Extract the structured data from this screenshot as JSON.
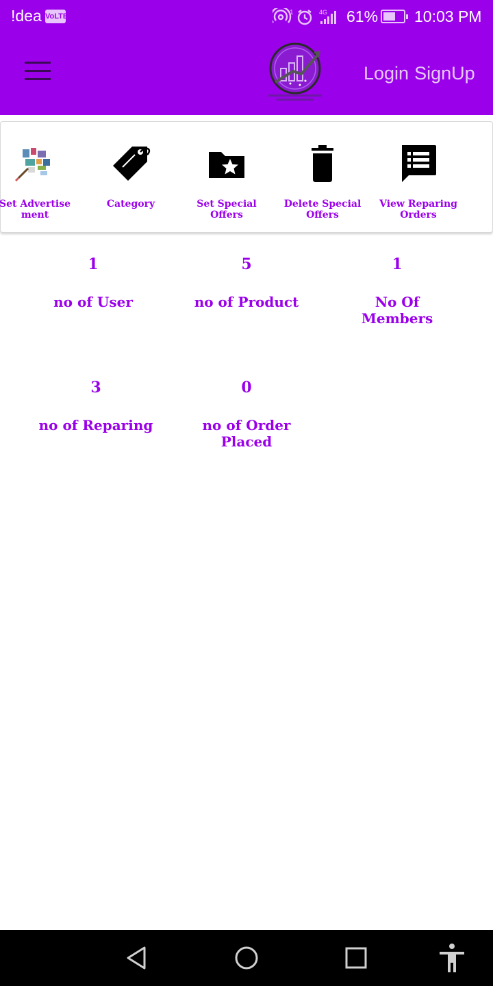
{
  "status_bar": {
    "carrier": "!dea",
    "volte": "VoLTE",
    "network_tag": "4G",
    "battery_pct": "61%",
    "battery_level": 0.61,
    "time": "10:03 PM"
  },
  "app_bar": {
    "menu_icon": "hamburger-icon",
    "logo_icon": "mobilesolution-logo",
    "login_label": "Login",
    "signup_label": "SignUp"
  },
  "actions": [
    {
      "label": "Set Advertise ment",
      "icon": "advertisement-icon"
    },
    {
      "label": "Category",
      "icon": "tag-icon"
    },
    {
      "label": "Set Special Offers",
      "icon": "folder-star-icon"
    },
    {
      "label": "Delete Special Offers",
      "icon": "trash-icon"
    },
    {
      "label": "View Reparing Orders",
      "icon": "message-list-icon"
    }
  ],
  "stats": [
    {
      "value": "1",
      "label": "no of User"
    },
    {
      "value": "5",
      "label": "no of Product"
    },
    {
      "value": "1",
      "label": "No Of Members"
    },
    {
      "value": "3",
      "label": "no of Reparing"
    },
    {
      "value": "0",
      "label": "no of Order Placed"
    }
  ],
  "colors": {
    "primary": "#9b00ea",
    "nav_bg": "#000000",
    "auth_text": "#e6c8f8"
  },
  "nav_bar": {
    "icons": [
      "back-icon",
      "home-icon",
      "recents-icon",
      "accessibility-icon"
    ]
  }
}
